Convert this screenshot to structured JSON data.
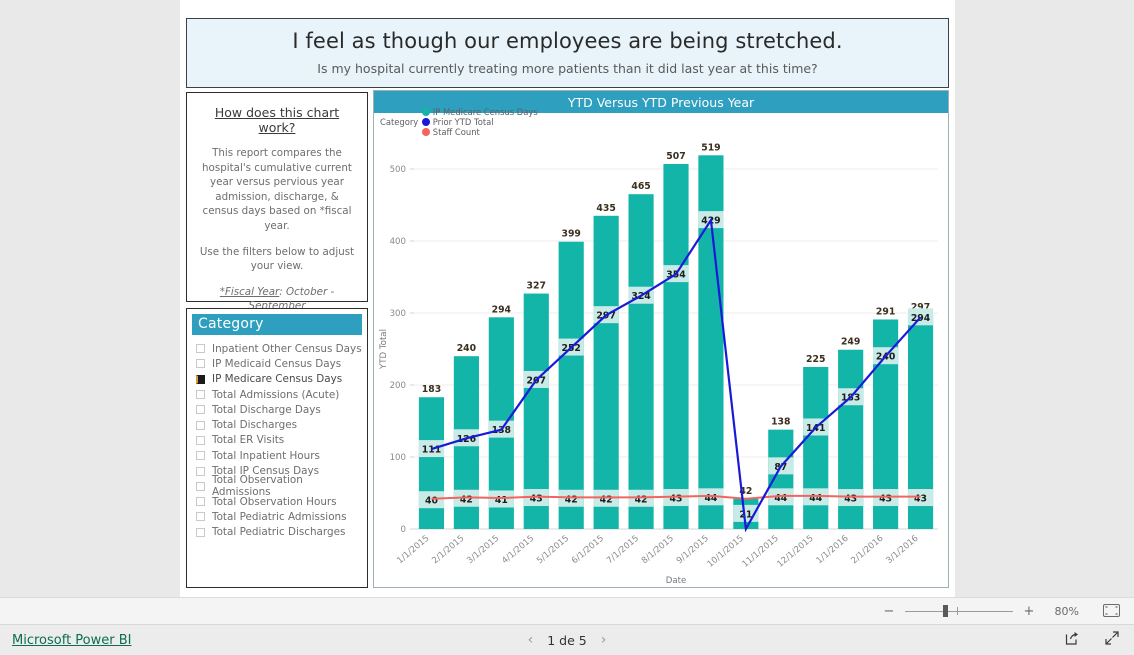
{
  "banner": {
    "title": "I feel as though our employees are being stretched.",
    "subtitle": "Is my hospital currently treating more patients than it did last year at this time?"
  },
  "info_card": {
    "heading": "How does this chart work?",
    "paragraph1": "This report compares the hospital's cumulative current year versus pervious year admission, discharge, & census days based on *fiscal year.",
    "paragraph2": "Use the filters below to adjust your view.",
    "fiscal_label": "*Fiscal Year",
    "fiscal_value": ": October - September"
  },
  "slicer": {
    "header": "Category",
    "items": [
      {
        "label": "Inpatient Other Census Days",
        "checked": false
      },
      {
        "label": "IP Medicaid Census Days",
        "checked": false
      },
      {
        "label": "IP Medicare Census Days",
        "checked": true
      },
      {
        "label": "Total Admissions (Acute)",
        "checked": false
      },
      {
        "label": "Total Discharge Days",
        "checked": false
      },
      {
        "label": "Total Discharges",
        "checked": false
      },
      {
        "label": "Total ER Visits",
        "checked": false
      },
      {
        "label": "Total Inpatient Hours",
        "checked": false
      },
      {
        "label": "Total IP Census Days",
        "checked": false
      },
      {
        "label": "Total Observation Admissions",
        "checked": false
      },
      {
        "label": "Total Observation Hours",
        "checked": false
      },
      {
        "label": "Total Pediatric Admissions",
        "checked": false
      },
      {
        "label": "Total Pediatric Discharges",
        "checked": false
      }
    ]
  },
  "chart_header": {
    "title": "YTD Versus YTD Previous Year",
    "legend_label": "Category",
    "legend": [
      {
        "name": "IP Medicare Census Days",
        "color": "#12b5a8"
      },
      {
        "name": "Prior YTD Total",
        "color": "#1a1ad6"
      },
      {
        "name": "Staff Count",
        "color": "#f4645f"
      }
    ]
  },
  "chart_data": {
    "type": "bar",
    "title": "YTD Versus YTD Previous Year",
    "xlabel": "Date",
    "ylabel": "YTD Total",
    "ylim": [
      0,
      500
    ],
    "yticks": [
      0,
      100,
      200,
      300,
      400,
      500
    ],
    "grid": true,
    "legend_position": "top-left",
    "categories": [
      "1/1/2015",
      "2/1/2015",
      "3/1/2015",
      "4/1/2015",
      "5/1/2015",
      "6/1/2015",
      "7/1/2015",
      "8/1/2015",
      "9/1/2015",
      "10/1/2015",
      "11/1/2015",
      "12/1/2015",
      "1/1/2016",
      "2/1/2016",
      "3/1/2016"
    ],
    "series": [
      {
        "name": "IP Medicare Census Days",
        "type": "bar",
        "color": "#12b5a8",
        "values": [
          183,
          240,
          294,
          327,
          399,
          435,
          465,
          507,
          519,
          42,
          138,
          225,
          249,
          291,
          297
        ]
      },
      {
        "name": "Prior YTD Total",
        "type": "line",
        "color": "#1a1ad6",
        "values": [
          111,
          126,
          138,
          207,
          252,
          297,
          324,
          354,
          429,
          0,
          87,
          141,
          183,
          240,
          294
        ]
      },
      {
        "name": "Staff Count",
        "type": "line",
        "color": "#f4645f",
        "values": [
          40,
          42,
          41,
          43,
          42,
          42,
          42,
          43,
          44,
          21,
          44,
          44,
          43,
          43,
          43
        ]
      }
    ]
  },
  "zoombar": {
    "minus": "−",
    "plus": "+",
    "zoom_level": "80%",
    "fit_icon": "fit-to-page-icon"
  },
  "footer": {
    "brand": "Microsoft Power BI",
    "prev": "‹",
    "next": "›",
    "page_indicator": "1 de 5",
    "share_icon": "share-icon",
    "fullscreen_icon": "fullscreen-icon"
  }
}
